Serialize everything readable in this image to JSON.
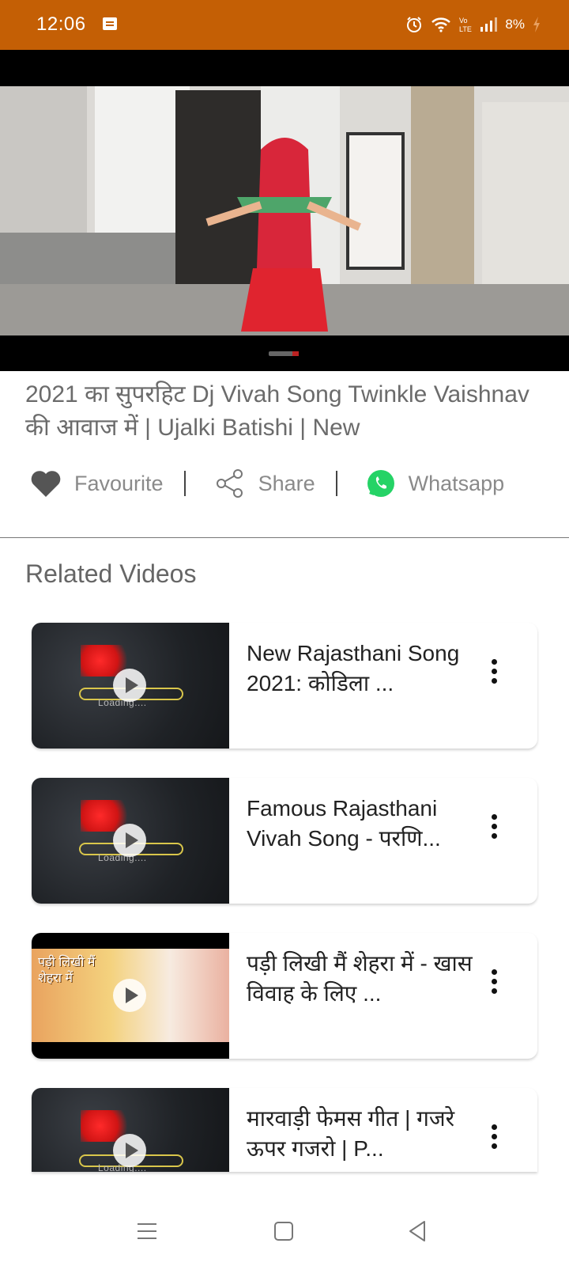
{
  "status_bar": {
    "time": "12:06",
    "battery": "8%",
    "icons": [
      "notification-icon",
      "alarm-icon",
      "wifi-icon",
      "volte-icon",
      "signal-icon",
      "battery-icon"
    ]
  },
  "video": {
    "title": "2021 का सुपरहिट Dj Vivah Song Twinkle Vaishnav की आवाज में | Ujalki Batishi | New"
  },
  "actions": {
    "favourite_label": "Favourite",
    "share_label": "Share",
    "whatsapp_label": "Whatsapp",
    "separator": "|"
  },
  "related": {
    "heading": "Related Videos",
    "items": [
      {
        "title": "New Rajasthani Song 2021: कोडिला ...",
        "thumb_text": "Loading...."
      },
      {
        "title": "Famous Rajasthani Vivah Song - परणि...",
        "thumb_text": "Loading...."
      },
      {
        "title": "पड़ी लिखी मैं शेहरा में - खास विवाह के लिए ...",
        "thumb_text": "पड़ी लिखी मैं शेहरा में"
      },
      {
        "title": "मारवाड़ी फेमस गीत | गजरे ऊपर गजरो | P...",
        "thumb_text": "Loading...."
      }
    ]
  },
  "colors": {
    "status_bar": "#c45f05",
    "whatsapp": "#25d366",
    "heart": "#555555"
  }
}
